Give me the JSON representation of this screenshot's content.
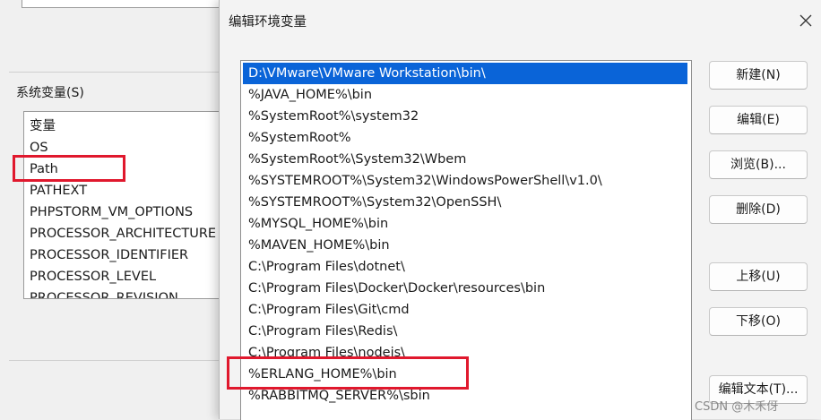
{
  "system_variables": {
    "label": "系统变量(S)",
    "rows": [
      "变量",
      "OS",
      "Path",
      "PATHEXT",
      "PHPSTORM_VM_OPTIONS",
      "PROCESSOR_ARCHITECTURE",
      "PROCESSOR_IDENTIFIER",
      "PROCESSOR_LEVEL",
      "PROCESSOR_REVISION"
    ],
    "selected": "Path"
  },
  "dialog": {
    "title": "编辑环境变量",
    "close_glyph": "✕",
    "paths": [
      "D:\\VMware\\VMware Workstation\\bin\\",
      "%JAVA_HOME%\\bin",
      "%SystemRoot%\\system32",
      "%SystemRoot%",
      "%SystemRoot%\\System32\\Wbem",
      "%SYSTEMROOT%\\System32\\WindowsPowerShell\\v1.0\\",
      "%SYSTEMROOT%\\System32\\OpenSSH\\",
      "%MYSQL_HOME%\\bin",
      "%MAVEN_HOME%\\bin",
      "C:\\Program Files\\dotnet\\",
      "C:\\Program Files\\Docker\\Docker\\resources\\bin",
      "C:\\Program Files\\Git\\cmd",
      "C:\\Program Files\\Redis\\",
      "C:\\Program Files\\nodejs\\",
      "%ERLANG_HOME%\\bin",
      "%RABBITMQ_SERVER%\\sbin"
    ],
    "selected_path": "D:\\VMware\\VMware Workstation\\bin\\",
    "highlighted_path": "%ERLANG_HOME%\\bin",
    "buttons": {
      "new": "新建(N)",
      "edit": "编辑(E)",
      "browse": "浏览(B)...",
      "delete": "删除(D)",
      "move_up": "上移(U)",
      "move_down": "下移(O)",
      "edit_text": "编辑文本(T)..."
    }
  },
  "watermark": "CSDN @木禾伢",
  "colors": {
    "selection": "#0a64d8",
    "annotation_red": "#e0182d"
  }
}
